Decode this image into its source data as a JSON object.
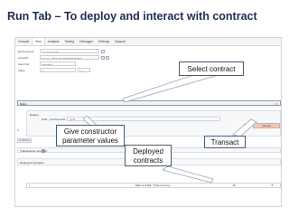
{
  "slide": {
    "title": "Run Tab – To deploy and interact with contract"
  },
  "menu": {
    "tabs": [
      "Compile",
      "Run",
      "Analysis",
      "Testing",
      "Debugger",
      "Settings",
      "Support"
    ]
  },
  "form": {
    "environment_label": "Environment",
    "environment_value": "JavaScript VM",
    "account_label": "Account",
    "account_value": "0xca3...a733c (99.9999999999999)",
    "gas_limit_label": "Gas limit",
    "gas_limit_value": "3000000",
    "value_label": "Value",
    "value_value": "0",
    "value_unit": "wei"
  },
  "contract_select": {
    "value": "Ballot"
  },
  "deploy": {
    "header": "Deploy",
    "ctor_param_label": "uint8 _numProposals",
    "ctor_input_value": "uint8",
    "transact_label": "transact"
  },
  "side_buttons": {
    "or_label": "or",
    "at_address_label": "At Address"
  },
  "transactions": {
    "label": "Transactions recorded:"
  },
  "deployed": {
    "label": "Deployed Contracts",
    "instance_name": "Ballot at 0x692...77b3a (memory)"
  },
  "callouts": {
    "select_contract": "Select contract",
    "constructor_line1": "Give constructor",
    "constructor_line2": "parameter values",
    "deployed_line1": "Deployed",
    "deployed_line2": "contracts",
    "transact": "Transact"
  },
  "icons": {
    "copy": "copy-icon",
    "trash": "trash-icon",
    "chevron": "chevron-right-icon"
  },
  "colors": {
    "title": "#1f2d4f",
    "transact_button": "#f3c9b5",
    "arrow": "#ffffff",
    "arrow_outline": "#9aa6bb"
  }
}
